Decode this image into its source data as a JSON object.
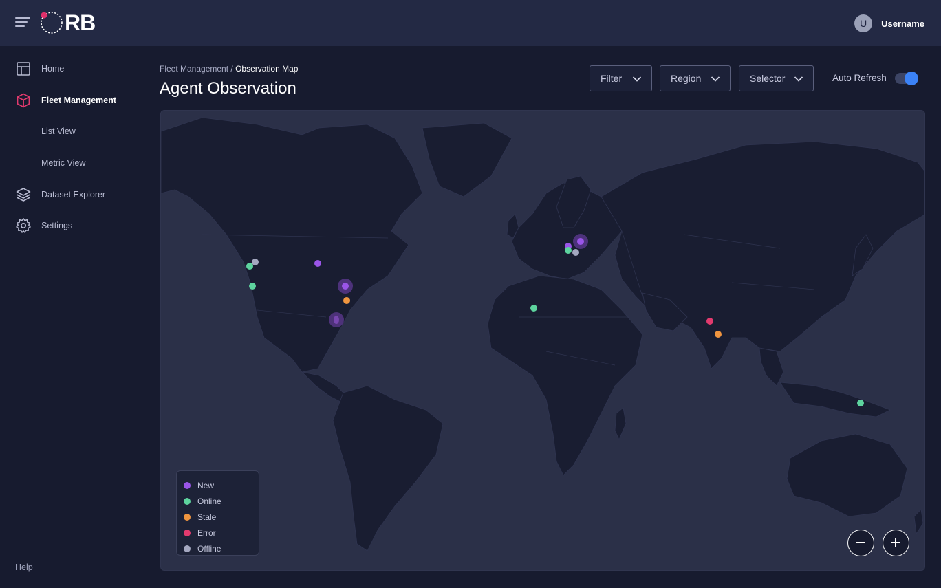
{
  "app": {
    "logo_text": "RB",
    "logo_accent": "#e0306b"
  },
  "user": {
    "initial": "U",
    "name": "Username"
  },
  "sidebar": {
    "items": [
      {
        "label": "Home",
        "icon": "layout-icon"
      },
      {
        "label": "Fleet Management",
        "icon": "cube-icon",
        "active": true
      },
      {
        "label": "List View"
      },
      {
        "label": "Metric View"
      },
      {
        "label": "Dataset Explorer",
        "icon": "layers-icon"
      },
      {
        "label": "Settings",
        "icon": "gear-icon"
      }
    ],
    "help": "Help"
  },
  "breadcrumb": {
    "parent": "Fleet Management",
    "separator": " / ",
    "current": "Observation Map"
  },
  "page_title": "Agent Observation",
  "filters": {
    "filter": "Filter",
    "region": "Region",
    "selector": "Selector",
    "auto_refresh_label": "Auto Refresh",
    "auto_refresh_on": true
  },
  "legend": [
    {
      "label": "New",
      "color": "#9a55e8"
    },
    {
      "label": "Online",
      "color": "#5dd39e"
    },
    {
      "label": "Stale",
      "color": "#f0953f"
    },
    {
      "label": "Error",
      "color": "#e23a6e"
    },
    {
      "label": "Offline",
      "color": "#a4a8c0"
    }
  ],
  "colors": {
    "accent": "#3b82f6",
    "map_land": "#191d31",
    "map_sea": "#2b3048"
  },
  "zoom": {
    "out_icon": "minus-icon",
    "in_icon": "plus-icon"
  }
}
